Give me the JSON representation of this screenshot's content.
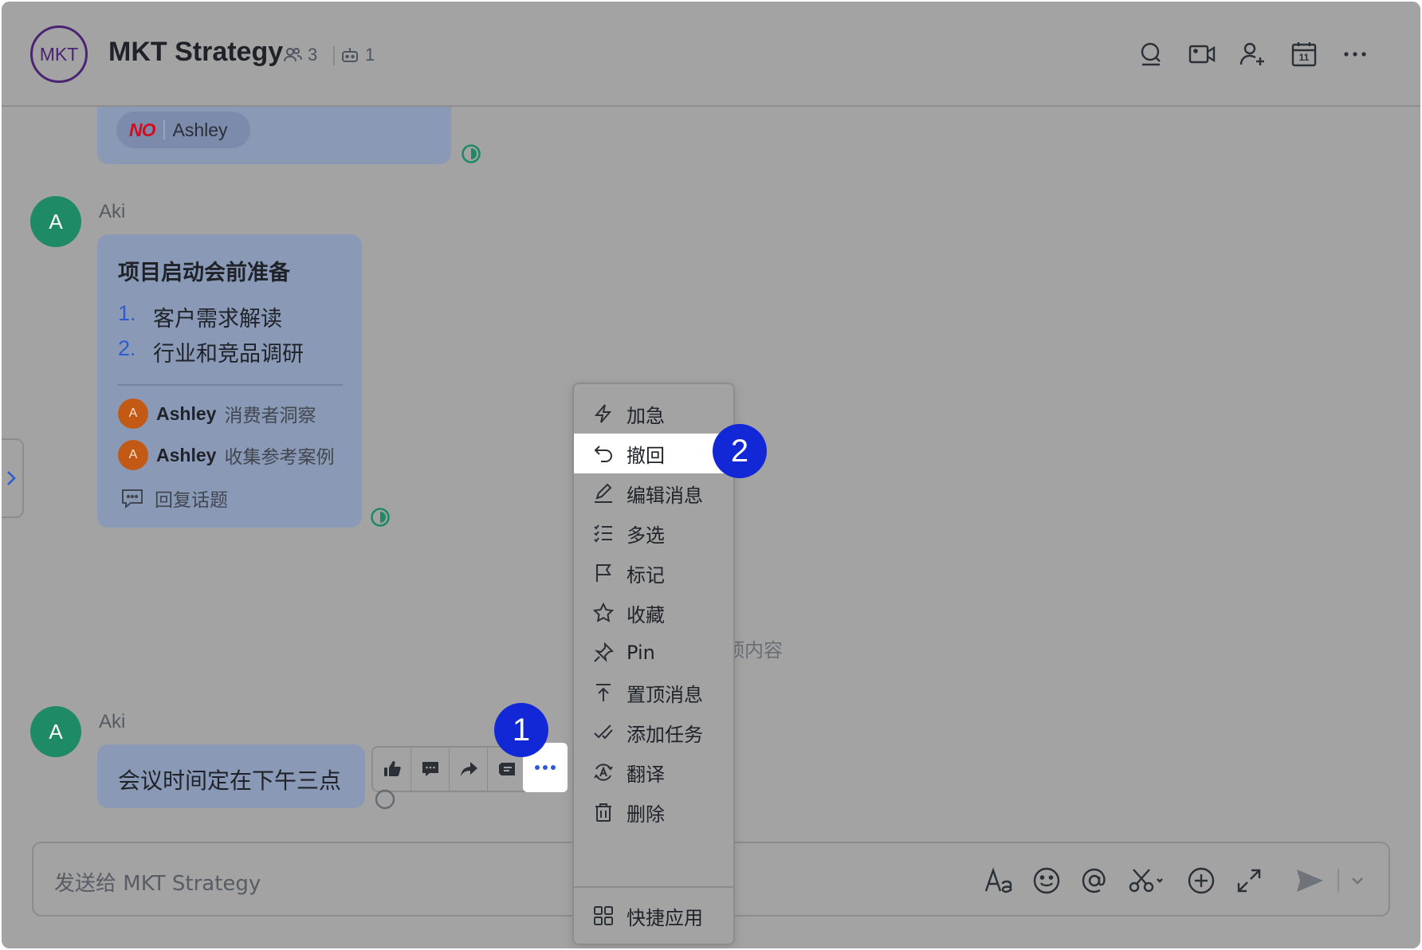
{
  "header": {
    "avatar_text": "MKT",
    "title": "MKT Strategy",
    "member_count": "3",
    "bot_count": "1",
    "icons": [
      "search-icon",
      "video-call-icon",
      "add-member-icon",
      "calendar-icon",
      "more-icon"
    ],
    "calendar_day": "11"
  },
  "messages": [
    {
      "chip": {
        "badge": "NO",
        "name": "Ashley"
      }
    },
    {
      "sender": "Aki",
      "avatar_letter": "A",
      "card": {
        "title": "项目启动会前准备",
        "items": [
          {
            "num": "1.",
            "text": "客户需求解读"
          },
          {
            "num": "2.",
            "text": "行业和竞品调研"
          }
        ],
        "tasks": [
          {
            "avatar": "A",
            "name": "Ashley",
            "desc": "消费者洞察"
          },
          {
            "avatar": "A",
            "name": "Ashley",
            "desc": "收集参考案例"
          }
        ],
        "reply_label": "回复话题"
      }
    },
    {
      "sender": "Aki",
      "avatar_letter": "A",
      "text": "会议时间定在下午三点"
    }
  ],
  "partial_text": "顶内容",
  "message_toolbar": {
    "icons": [
      "thumbs-up-icon",
      "reply-icon",
      "forward-icon",
      "quote-icon",
      "more-icon"
    ]
  },
  "context_menu": {
    "items": [
      {
        "label": "加急",
        "icon": "bolt-icon"
      },
      {
        "label": "撤回",
        "icon": "undo-icon"
      },
      {
        "label": "编辑消息",
        "icon": "edit-icon"
      },
      {
        "label": "多选",
        "icon": "multi-select-icon"
      },
      {
        "label": "标记",
        "icon": "flag-icon"
      },
      {
        "label": "收藏",
        "icon": "star-icon"
      },
      {
        "label": "Pin",
        "icon": "pin-icon"
      },
      {
        "label": "置顶消息",
        "icon": "pin-top-icon"
      },
      {
        "label": "添加任务",
        "icon": "task-icon"
      },
      {
        "label": "翻译",
        "icon": "translate-icon"
      },
      {
        "label": "删除",
        "icon": "trash-icon"
      },
      {
        "label": "快捷应用",
        "icon": "apps-icon"
      }
    ],
    "highlighted": "撤回"
  },
  "step_badges": [
    "1",
    "2"
  ],
  "composer": {
    "placeholder": "发送给 MKT Strategy",
    "icons": [
      "text-format-icon",
      "emoji-icon",
      "mention-icon",
      "screenshot-icon",
      "add-icon",
      "expand-icon",
      "send-icon",
      "send-options-icon"
    ]
  },
  "colors": {
    "overlay": "#a3a3a3",
    "bubble": "#8a99b5",
    "avatar_green": "#1f8a66",
    "badge_blue": "#1228d6",
    "list_number_blue": "#2f5bd0",
    "no_red": "#d40d1c"
  }
}
